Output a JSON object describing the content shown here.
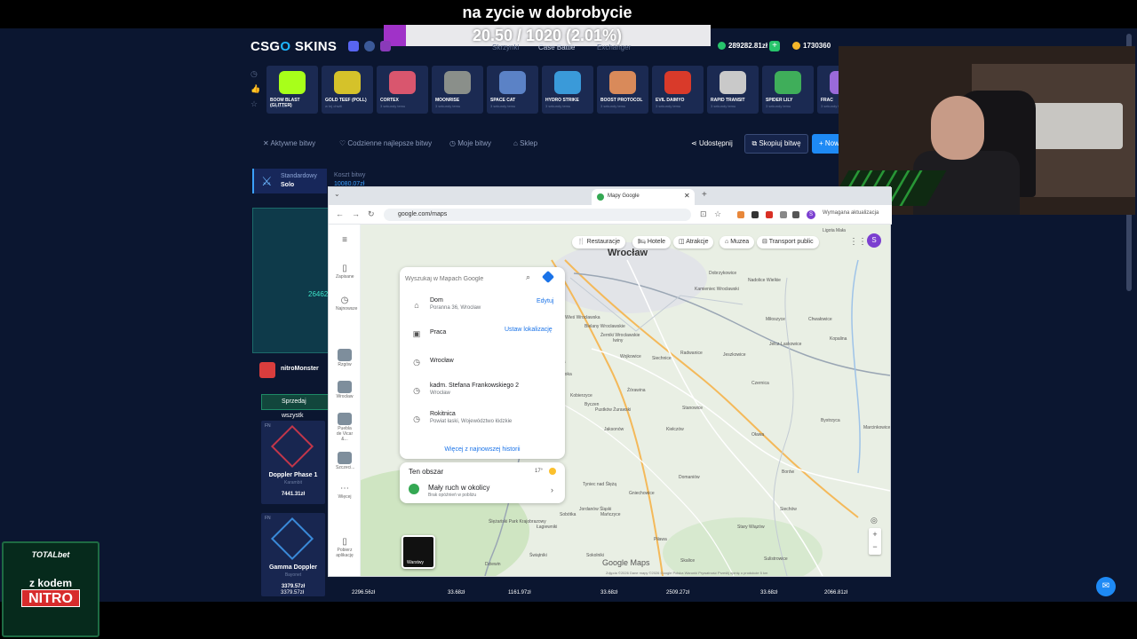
{
  "overlay": {
    "title": "na zycie w dobrobycie",
    "progress_text": "20.50 / 1020 (2.01%)",
    "progress_fraction": 0.0201,
    "accent": "#a032c8"
  },
  "site": {
    "logo_left": "CSG",
    "logo_o": "O",
    "logo_right": "SKINS",
    "nav": [
      "Skrzynki",
      "Case Battle",
      "Exchanger"
    ],
    "balance_1": "289282.81zł",
    "balance_2": "1730360",
    "cases": [
      {
        "name": "BOOM BLAST (GLITTER)",
        "sub": "w tej chwili",
        "color": "#a8ff1a"
      },
      {
        "name": "GOLD TEEF (POLL)",
        "sub": "w tej chwili",
        "color": "#d5c22a"
      },
      {
        "name": "CORTEX",
        "sub": "3 sekundy temu",
        "color": "#d9566e"
      },
      {
        "name": "MOONRISE",
        "sub": "3 sekundy temu",
        "color": "#8a8f8a"
      },
      {
        "name": "SPACE CAT",
        "sub": "3 sekundy temu",
        "color": "#5b82c6"
      },
      {
        "name": "HYDRO STRIKE",
        "sub": "3 sekundy temu",
        "color": "#3a9ad9"
      },
      {
        "name": "BOOST PROTOCOL",
        "sub": "3 sekundy temu",
        "color": "#d98a5a"
      },
      {
        "name": "EVIL DAIMYO",
        "sub": "3 sekundy temu",
        "color": "#d93a2a"
      },
      {
        "name": "RAPID TRANSIT",
        "sub": "3 sekundy temu",
        "color": "#c9c9c9"
      },
      {
        "name": "SPIDER LILY",
        "sub": "3 sekundy temu",
        "color": "#3fae5a"
      },
      {
        "name": "FRAC",
        "sub": "3 sekundy temu",
        "color": "#9a6ad9"
      }
    ],
    "tabs": [
      "Aktywne bitwy",
      "Codzienne najlepsze bitwy",
      "Moje bitwy",
      "Sklep"
    ],
    "share": "Udostępnij",
    "copy_battle": "Skopiuj bitwę",
    "new_label": "Now",
    "mode_l1": "Standardowy",
    "mode_l2": "Solo",
    "cost_label": "Koszt bitwy",
    "cost_value": "10080.07zł",
    "battle_amount": "26462",
    "player_name": "nitroMonster",
    "sell_all": "Sprzedaj wszystk",
    "items": [
      {
        "top": "FN",
        "name": "Doppler Phase 1",
        "sub": "Karambit",
        "price": "7441.31zł"
      },
      {
        "top": "FN",
        "name": "Gamma Doppler",
        "sub": "Bayonet",
        "price": "3379.57zł"
      }
    ],
    "bottom_prices": [
      "3379.57zł",
      "2296.56zł",
      "33.68zł",
      "1161.97zł",
      "33.68zł",
      "2509.27zł",
      "33.68zł",
      "2066.81zł"
    ]
  },
  "promo": {
    "brand": "TOTALbet",
    "line1": "z kodem",
    "code": "NITRO"
  },
  "browser": {
    "tab_title": "Mapy Google",
    "url": "google.com/maps",
    "update_label": "Wymagana aktualizacja",
    "profile_initial": "S"
  },
  "maps": {
    "search_placeholder": "Wyszukaj w Mapach Google",
    "history": [
      {
        "icon": "home",
        "t1": "Dom",
        "t2": "Poranna 36, Wrocław",
        "action": "Edytuj"
      },
      {
        "icon": "work",
        "t1": "Praca",
        "t2": "",
        "action": "Ustaw lokalizację"
      },
      {
        "icon": "clock",
        "t1": "Wrocław",
        "t2": "",
        "action": ""
      },
      {
        "icon": "clock",
        "t1": "kadm. Stefana Frankowskiego 2",
        "t2": "Wrocław",
        "action": ""
      },
      {
        "icon": "clock",
        "t1": "Rokitnica",
        "t2": "Powiat łaski, Województwo łódzkie",
        "action": ""
      }
    ],
    "more_history": "Więcej z najnowszej historii",
    "area_title": "Ten obszar",
    "area_temp": "17°",
    "traffic_title": "Mały ruch w okolicy",
    "traffic_sub": "Brak opóźnień w pobliżu",
    "chips": [
      "Restauracje",
      "Hotele",
      "Atrakcje",
      "Muzea",
      "Transport public"
    ],
    "rail": [
      {
        "icon": "bookmark",
        "label": "Zapisane"
      },
      {
        "icon": "history",
        "label": "Najnowsze"
      },
      {
        "icon": "place",
        "label": "Rzgów"
      },
      {
        "icon": "place",
        "label": "Wrocław"
      },
      {
        "icon": "place",
        "label": "Puebla de Vicar &..."
      },
      {
        "icon": "place",
        "label": "Szczeci..."
      },
      {
        "icon": "more",
        "label": "Więcej"
      },
      {
        "icon": "phone",
        "label": "Pobierz aplikację"
      }
    ],
    "city": "Wrocław",
    "places": [
      "Ligota Mała",
      "Dobrzykowice",
      "Kamieniec Wrocławski",
      "Nadolice Wielkie",
      "Miłoszyce",
      "Chwałowice",
      "Kopalina",
      "Nowa Wieś Wrocławska",
      "Bielany Wrocławskie",
      "Żerniki Wrocławskie",
      "Iwiny",
      "Siechnice",
      "Jeszkowice",
      "Wojkowice",
      "Radwanice",
      "Jelcz-Laskowice",
      "Czernica",
      "Ślęza",
      "Kobierzyce",
      "Żórawina",
      "Wysoka",
      "Kiełczów",
      "Byczen",
      "Jaksonów",
      "Domaniów",
      "Oława",
      "Stanowice",
      "Bystrzyca",
      "Marcinkowice",
      "Tyniec nad Ślężą",
      "Pustków Żurawski",
      "Borów",
      "Siechów",
      "Strzegomiany",
      "Ślężański Park Krajobrazowy",
      "Sobótka",
      "Mańczyce",
      "Jordanów Śląski",
      "Gniechowice",
      "Piława",
      "Stary Wiązów",
      "Skalice",
      "Sulistrowice",
      "Łagiewniki",
      "Kąty Wrocławskie",
      "Świątniki",
      "Sokolniki",
      "Dziewin"
    ],
    "layers_label": "Warstwy",
    "logo": "Google Maps",
    "legal": "Zdjęcia ©2026 Dane mapy ©2026 Google   Polska   Warunki   Prywatność   Prześlij opinię o produkcie   5 km"
  }
}
